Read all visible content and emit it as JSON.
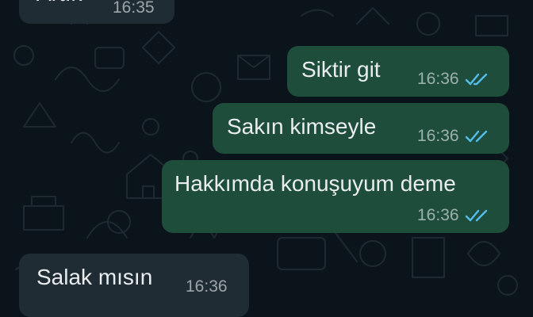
{
  "messages": [
    {
      "direction": "incoming",
      "text": "Artık",
      "time": "16:35"
    },
    {
      "direction": "outgoing",
      "text": "Siktir git",
      "time": "16:36",
      "status": "read-double-check-icon"
    },
    {
      "direction": "outgoing",
      "text": "Sakın kimseyle",
      "time": "16:36",
      "status": "read-double-check-icon"
    },
    {
      "direction": "outgoing",
      "text": "Hakkımda konuşuyum deme",
      "time": "16:36",
      "status": "read-double-check-icon"
    },
    {
      "direction": "incoming",
      "text": "Salak mısın",
      "time": "16:36"
    }
  ],
  "colors": {
    "background": "#0b141a",
    "incoming_bubble": "#202c33",
    "outgoing_bubble": "#1f4d3b",
    "read_tick": "#53bdeb",
    "wallpaper_doodle": "#1d2a31"
  }
}
